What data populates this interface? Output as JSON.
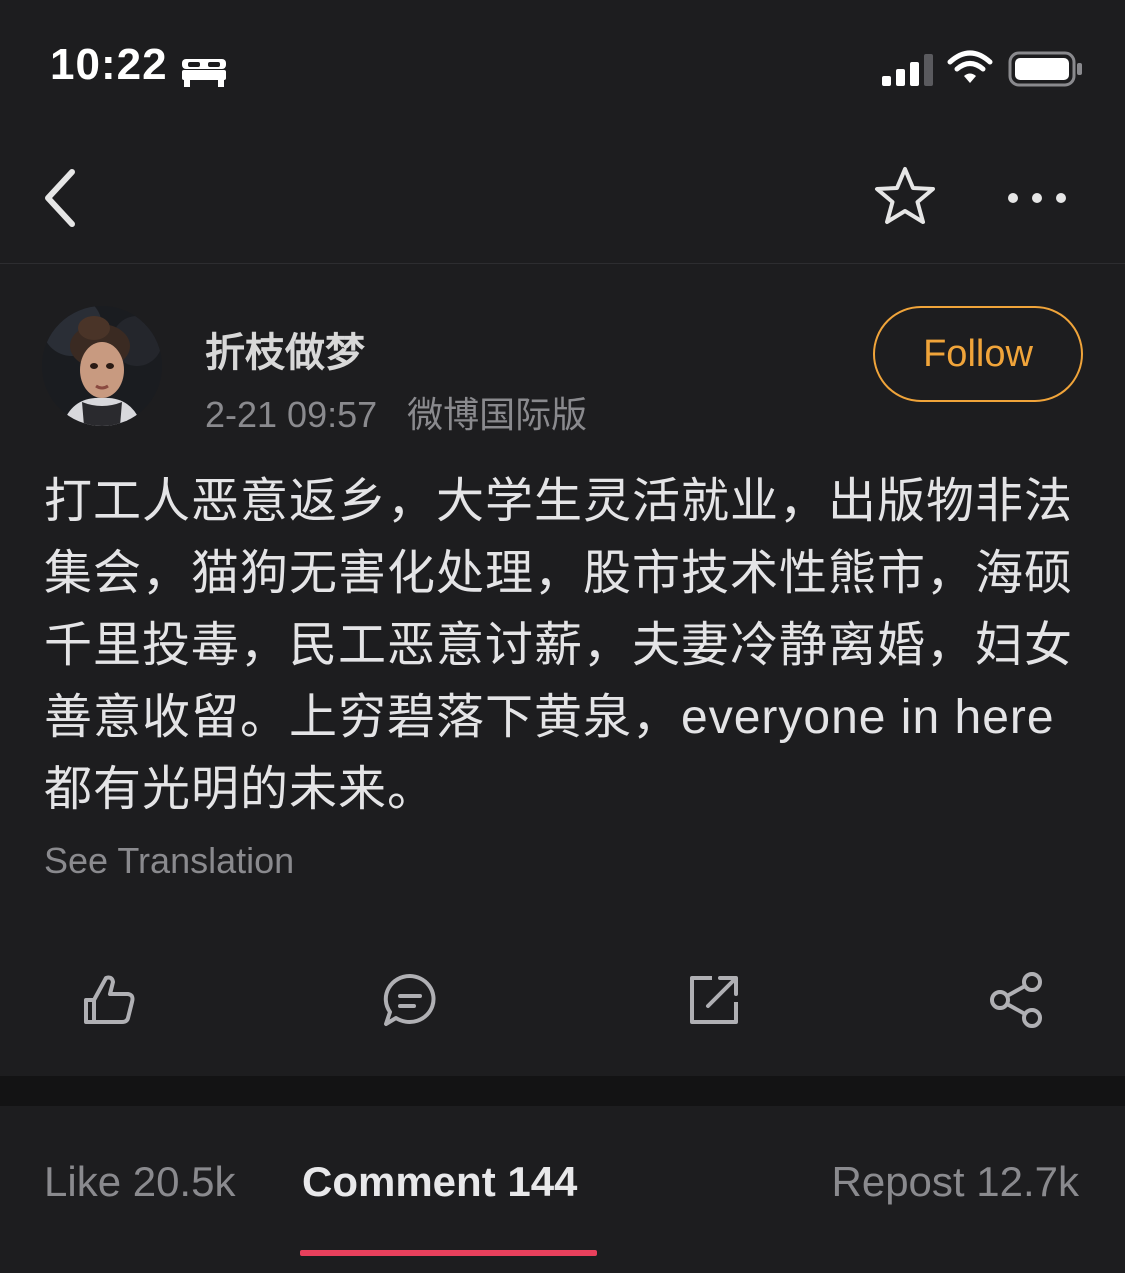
{
  "status_bar": {
    "time": "10:22",
    "icons": [
      "bed-icon",
      "signal-icon",
      "wifi-icon",
      "battery-icon"
    ]
  },
  "nav": {
    "icons": [
      "back-icon",
      "star-icon",
      "more-icon"
    ]
  },
  "post": {
    "author": "折枝做梦",
    "timestamp": "2-21 09:57",
    "source": "微博国际版",
    "follow_label": "Follow",
    "text": "打工人恶意返乡，大学生灵活就业，出版物非法集会，猫狗无害化处理，股市技术性熊市，海硕千里投毒，民工恶意讨薪，夫妻冷静离婚，妇女善意收留。上穷碧落下黄泉，everyone in here都有光明的未来。",
    "see_translation": "See Translation"
  },
  "actions": [
    "like-icon",
    "comment-icon",
    "repost-icon",
    "share-icon"
  ],
  "tabs": {
    "like": "Like 20.5k",
    "comment": "Comment 144",
    "repost": "Repost 12.7k",
    "active": "comment"
  },
  "colors": {
    "background": "#1d1d1f",
    "accent_follow": "#f0a43a",
    "tab_underline": "#e8405c",
    "secondary_text": "#8a8a8e"
  }
}
